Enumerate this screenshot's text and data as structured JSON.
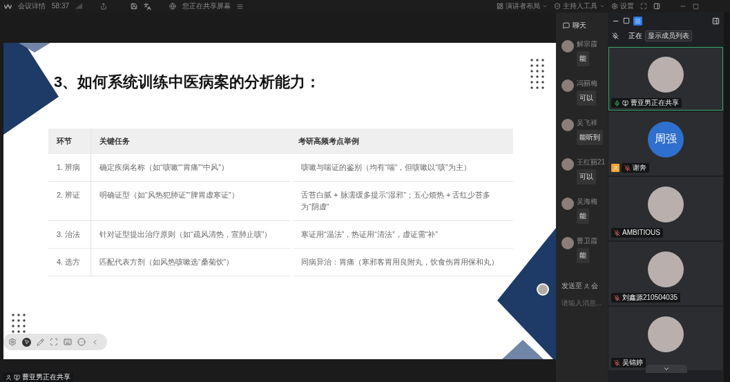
{
  "top_bar": {
    "title": "会议详情",
    "timer": "58:37",
    "share_notice": "您正在共享屏幕",
    "menus": [
      {
        "kind": "layout",
        "label": "演讲者布局",
        "dropdown": true
      },
      {
        "kind": "host",
        "label": "主持人工具",
        "dropdown": true
      },
      {
        "kind": "settings",
        "label": "设置",
        "dropdown": false
      }
    ]
  },
  "slide": {
    "title": "3、如何系统训练中医病案的分析能力：",
    "table": {
      "columns": [
        "环节",
        "关键任务",
        "考研高频考点举例"
      ],
      "rows": [
        [
          "1. 辨病",
          "确定疾病名称（如“咳嗽”“胃痛”“中风”）",
          "咳嗽与喘证的鉴别（均有“喘”，但咳嗽以“咳”为主）"
        ],
        [
          "2. 辨证",
          "明确证型（如“风热犯肺证”“脾胃虚寒证”）",
          "舌苔白腻 + 脉濡缓多提示“湿邪”；五心烦热 + 舌红少苔多为“阴虚”"
        ],
        [
          "3. 治法",
          "针对证型提出治疗原则（如“疏风清热，宣肺止咳”）",
          "寒证用“温法”，热证用“清法”，虚证需“补”"
        ],
        [
          "4. 选方",
          "匹配代表方剂（如风热咳嗽选“桑菊饮”）",
          "同病异治：胃痛（寒邪客胃用良附丸，饮食伤胃用保和丸）"
        ]
      ]
    }
  },
  "chat": {
    "title": "聊天",
    "messages": [
      {
        "sender": "解宗霞",
        "text": "能"
      },
      {
        "sender": "冯丽梅",
        "text": "可以"
      },
      {
        "sender": "吴飞祥",
        "text": "能听到"
      },
      {
        "sender": "王红丽21",
        "text": "可以"
      },
      {
        "sender": "吴海梅",
        "text": "能"
      },
      {
        "sender": "曹卫霞",
        "text": "能"
      }
    ],
    "send_to": {
      "label": "发送至",
      "target": "会"
    },
    "input": {
      "placeholder": "请输入消息..."
    }
  },
  "participants": {
    "status_text": "正在",
    "tooltip": "显示成员列表",
    "tiles": [
      {
        "name": "曹亚男正在共享",
        "avatar": {
          "kind": "photo"
        },
        "selected": true,
        "muted": false,
        "host": false,
        "sharing": true
      },
      {
        "name": "谢奔",
        "avatar": {
          "kind": "initials",
          "text": "周强"
        },
        "selected": false,
        "muted": true,
        "host": true,
        "sharing": false
      },
      {
        "name": "AMBITIOUS",
        "avatar": {
          "kind": "photo"
        },
        "selected": false,
        "muted": true,
        "host": false,
        "sharing": false
      },
      {
        "name": "刘鑫源210504035",
        "avatar": {
          "kind": "photo"
        },
        "selected": false,
        "muted": true,
        "host": false,
        "sharing": false
      },
      {
        "name": "吴锦婷",
        "avatar": {
          "kind": "photo"
        },
        "selected": false,
        "muted": true,
        "host": false,
        "sharing": false
      }
    ]
  },
  "share_status": {
    "text": "曹亚男正在共享"
  }
}
